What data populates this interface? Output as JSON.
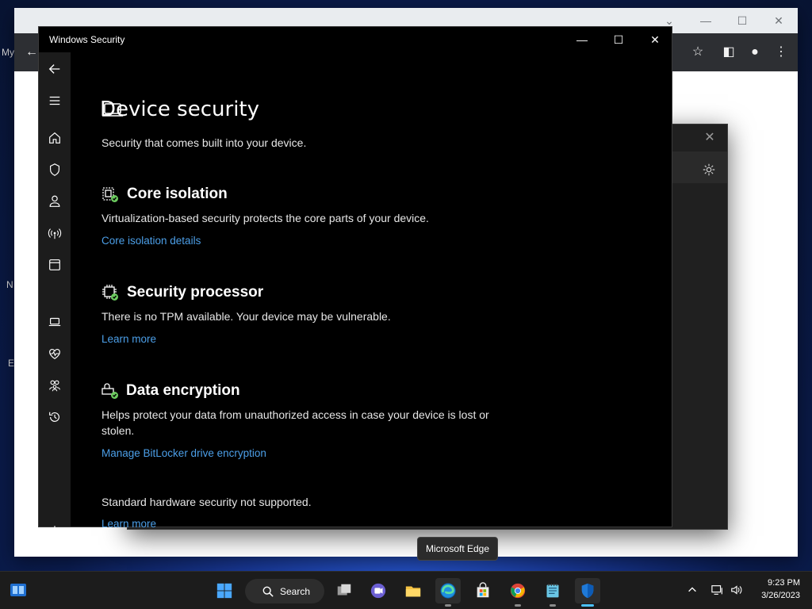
{
  "window": {
    "title": "Windows Security",
    "minimize": "—",
    "maximize": "☐",
    "close": "✕"
  },
  "page": {
    "title": "Device security",
    "subtitle": "Security that comes built into your device."
  },
  "sections": [
    {
      "title": "Core isolation",
      "desc": "Virtualization-based security protects the core parts of your device.",
      "link": "Core isolation details",
      "icon": "core-isolation-icon"
    },
    {
      "title": "Security processor",
      "desc": "There is no TPM available. Your device may be vulnerable.",
      "link": "Learn more",
      "icon": "processor-icon"
    },
    {
      "title": "Data encryption",
      "desc": "Helps protect your data from unauthorized access in case your device is lost or stolen.",
      "link": "Manage BitLocker drive encryption",
      "icon": "encryption-icon"
    }
  ],
  "footer": {
    "text": "Standard hardware security not supported.",
    "link": "Learn more"
  },
  "nav": [
    "back-icon",
    "menu-icon",
    "home-icon",
    "shield-icon",
    "person-icon",
    "wireless-icon",
    "browser-icon",
    "laptop-icon",
    "heartbeat-icon",
    "family-icon",
    "history-icon",
    "gear-icon"
  ],
  "tooltip": "Microsoft Edge",
  "taskbar": {
    "search_label": "Search",
    "time": "9:23 PM",
    "date": "3/26/2023"
  },
  "desktop_fragments": {
    "my": "My",
    "n": "N",
    "e": "E"
  },
  "colors": {
    "accent_link": "#4c9fe8",
    "nav_indicator": "#4cc2ff",
    "status_green": "#6ccb5f"
  }
}
